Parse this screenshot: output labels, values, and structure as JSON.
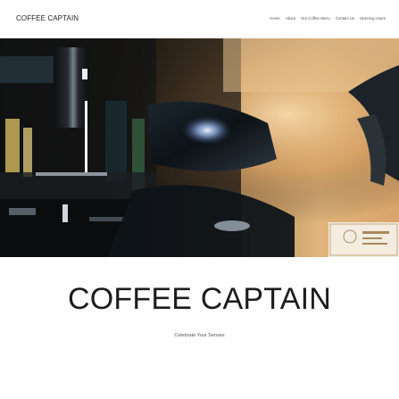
{
  "header": {
    "logo": "COFFEE CAPTAIN",
    "nav": [
      "Home",
      "About",
      "Our Coffee Menu",
      "Contact Us",
      "Opening Hours"
    ]
  },
  "hero": {
    "image": "espresso-machine-photo"
  },
  "main": {
    "title": "COFFEE CAPTAIN",
    "tagline": "Celebrate Your Senses"
  }
}
